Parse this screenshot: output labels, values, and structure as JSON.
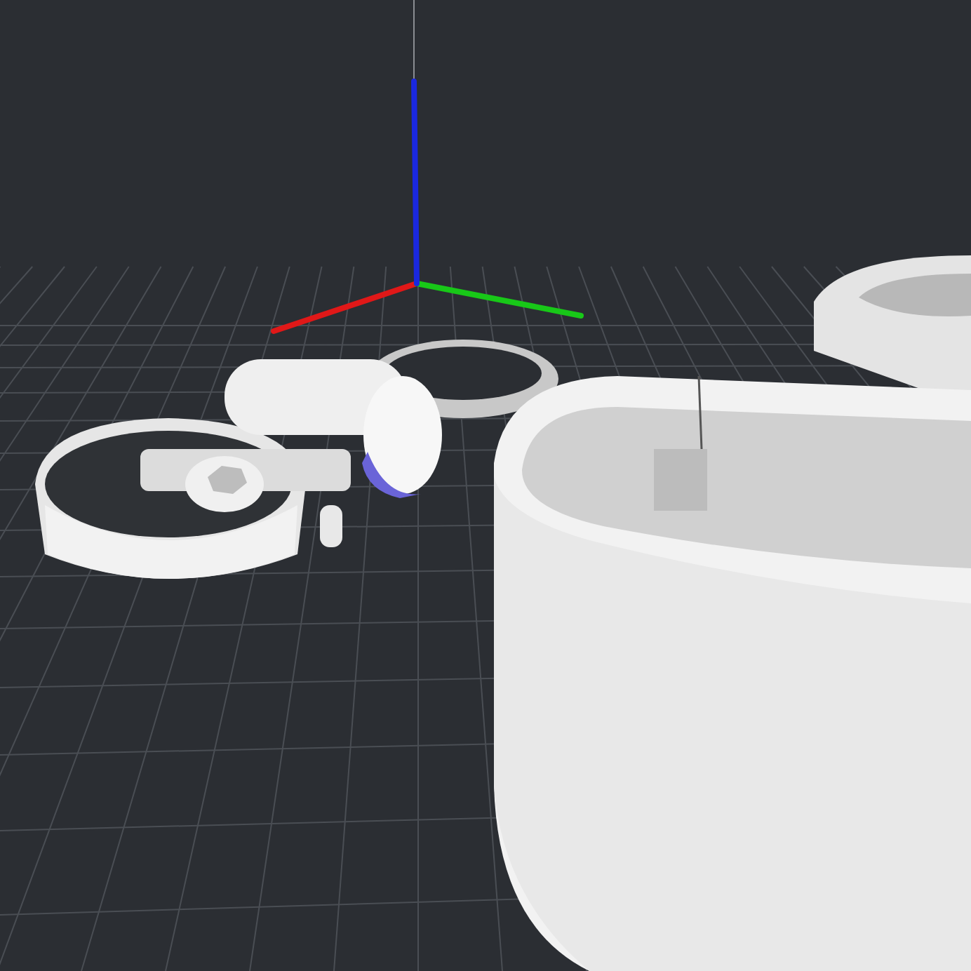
{
  "axes": [
    {
      "kind": "x",
      "color": "#e01818"
    },
    {
      "kind": "y",
      "color": "#18c818"
    },
    {
      "kind": "z",
      "color": "#1a28e0"
    }
  ]
}
